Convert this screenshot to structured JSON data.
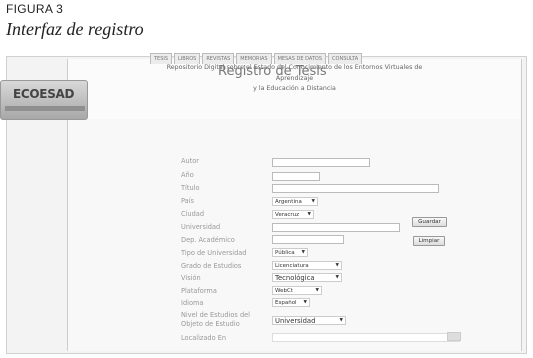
{
  "figure": {
    "label": "FIGURA 3",
    "caption": "Interfaz de registro"
  },
  "header": {
    "title_lines": [
      "Repositorio Digital sobre el Estado del Conocimiento de los Entornos Virtuales de",
      "Aprendizaje",
      "y la Educación a Distancia"
    ]
  },
  "tabs": [
    "TESIS",
    "LIBROS",
    "REVISTAS",
    "MEMORIAS",
    "MESAS DE DATOS",
    "CONSULTA"
  ],
  "form": {
    "title": "Registro de Tesis",
    "labels": {
      "autor": "Autor",
      "anio": "Año",
      "titulo": "Título",
      "pais": "País",
      "ciudad": "Ciudad",
      "universidad": "Universidad",
      "dep": "Dep. Académico",
      "tipo_univ": "Tipo de Universidad",
      "grado": "Grado de Estudios",
      "vision": "Visión",
      "plataforma": "Plataforma",
      "idioma": "Idioma",
      "nivel_l1": "Nivel de Estudios del",
      "nivel_l2": "Objeto de Estudio",
      "localizado": "Localizado En"
    },
    "values": {
      "pais": "Argentina",
      "ciudad": "Veracruz",
      "tipo_univ": "Pública",
      "grado": "Licenciatura",
      "vision": "Tecnológica",
      "plataforma": "WebCt",
      "idioma": "Español",
      "nivel": "Universidad"
    },
    "buttons": {
      "guardar": "Guardar",
      "limpiar": "Limpiar"
    }
  },
  "logo": {
    "text": "ECOESAD"
  }
}
